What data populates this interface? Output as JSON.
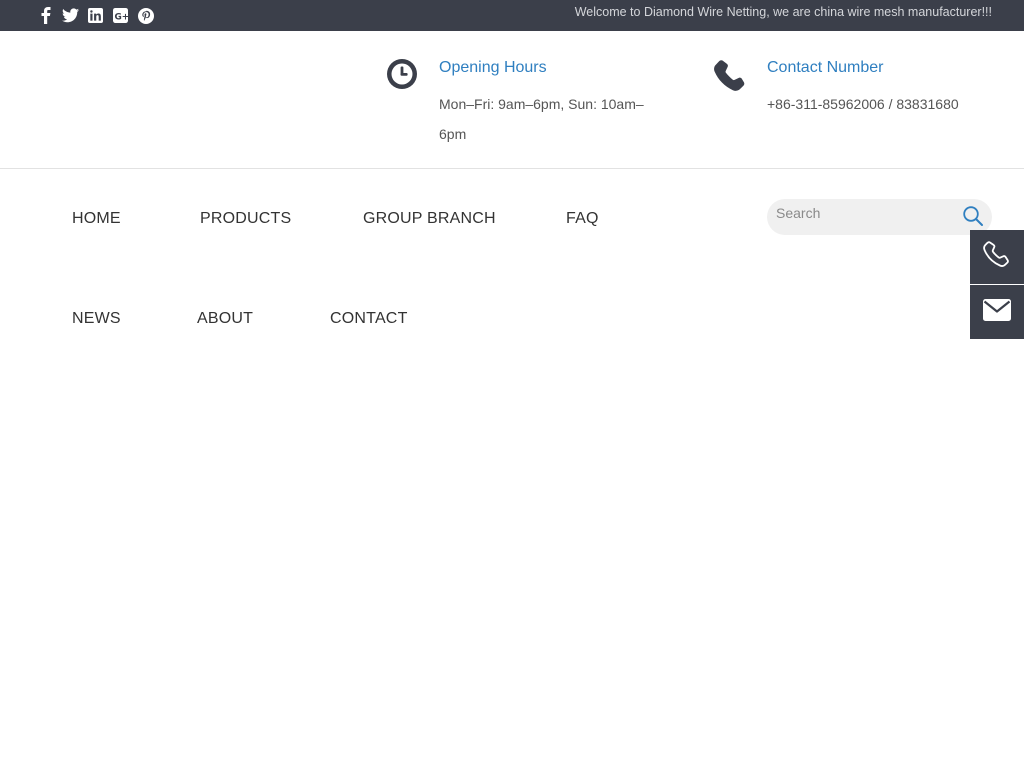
{
  "topbar": {
    "social_icons": [
      "facebook-icon",
      "twitter-icon",
      "linkedin-icon",
      "google-plus-icon",
      "pinterest-icon"
    ],
    "welcome_text": "Welcome to Diamond Wire Netting, we are china wire mesh manufacturer!!!",
    "background": "#3b3f4a"
  },
  "header": {
    "hours": {
      "icon": "clock-icon",
      "title": "Opening Hours",
      "text": "Mon–Fri: 9am–6pm,   Sun: 10am–6pm"
    },
    "contact": {
      "icon": "phone-icon",
      "title": "Contact Number",
      "text": "+86-311-85962006 / 83831680"
    },
    "accent": "#2f7fc0"
  },
  "nav": {
    "items": [
      {
        "label": "HOME"
      },
      {
        "label": "PRODUCTS"
      },
      {
        "label": "GROUP BRANCH"
      },
      {
        "label": "FAQ"
      },
      {
        "label": "NEWS"
      },
      {
        "label": "ABOUT"
      },
      {
        "label": "CONTACT"
      }
    ]
  },
  "search": {
    "placeholder": "Search",
    "icon": "search-icon"
  },
  "float_bar": {
    "buttons": [
      "phone-icon",
      "email-icon"
    ]
  }
}
